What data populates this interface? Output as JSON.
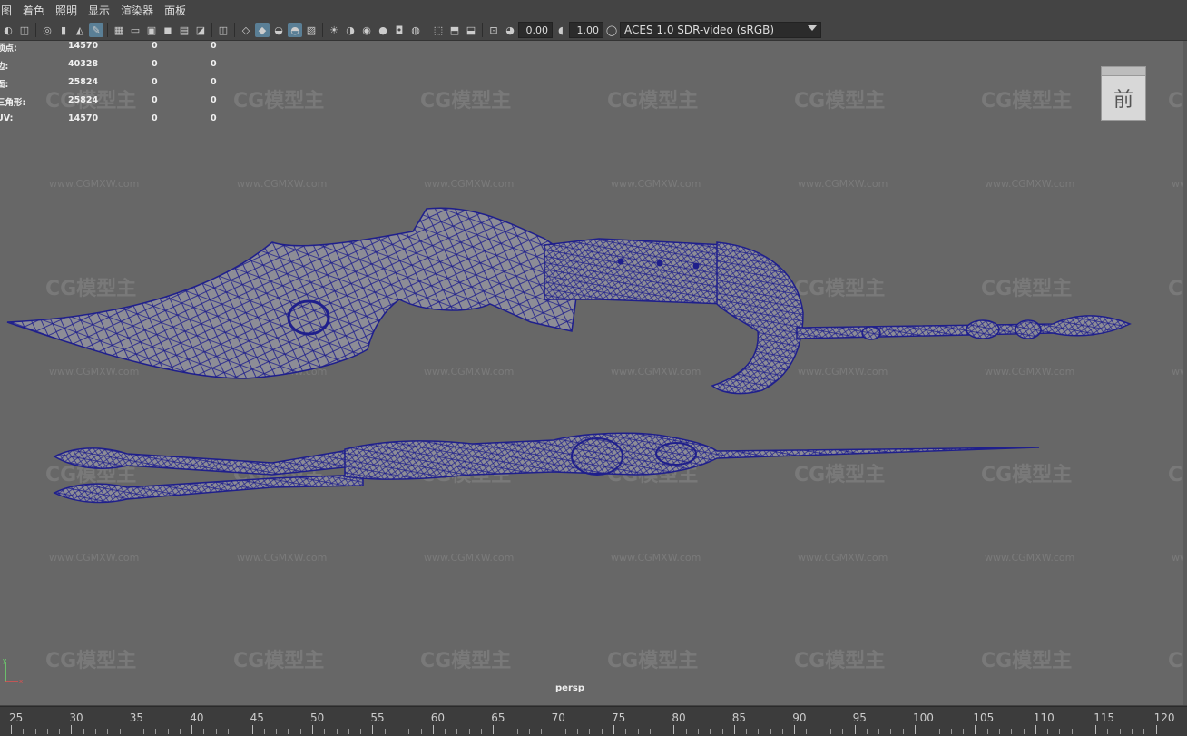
{
  "menu": {
    "items": [
      "图",
      "着色",
      "照明",
      "显示",
      "渲染器",
      "面板"
    ]
  },
  "toolbar": {
    "exposure_value": "0.00",
    "gamma_value": "1.00",
    "color_space": "ACES 1.0 SDR-video (sRGB)",
    "icons": [
      "camera-select-icon",
      "camera-attr-icon",
      "bookmark-icon",
      "image-plane-icon",
      "2d-pan-icon",
      "grease-pencil-icon",
      "grid-icon",
      "film-gate-icon",
      "resolution-gate-icon",
      "gate-mask-icon",
      "field-chart-icon",
      "safe-action-icon",
      "safe-title-icon",
      "wireframe-icon",
      "smooth-shade-icon",
      "default-material-icon",
      "wireframe-on-shaded-icon",
      "xray-icon",
      "use-all-lights-icon",
      "shadows-icon",
      "screen-space-ao-icon",
      "motion-blur-icon",
      "anti-alias-icon",
      "depth-of-field-icon",
      "isolate-select-icon",
      "xray-joints-icon",
      "xray-active-icon",
      "frame-all-icon",
      "exposure-icon",
      "gamma-icon",
      "color-mgmt-icon"
    ]
  },
  "hud": {
    "rows": [
      {
        "label": "顶点:",
        "v1": "14570",
        "v2": "0",
        "v3": "0"
      },
      {
        "label": "边:",
        "v1": "40328",
        "v2": "0",
        "v3": "0"
      },
      {
        "label": "面:",
        "v1": "25824",
        "v2": "0",
        "v3": "0"
      },
      {
        "label": "三角形:",
        "v1": "25824",
        "v2": "0",
        "v3": "0"
      },
      {
        "label": "UV:",
        "v1": "14570",
        "v2": "0",
        "v3": "0"
      }
    ]
  },
  "viewcube": {
    "face_label": "前"
  },
  "camera": {
    "name": "persp"
  },
  "watermark": {
    "logo": "CG模型主",
    "url": "www.CGMXW.com"
  },
  "ruler": {
    "labels": [
      "25",
      "30",
      "35",
      "40",
      "45",
      "50",
      "55",
      "60",
      "65",
      "70",
      "75",
      "80",
      "85",
      "90",
      "95",
      "100",
      "105",
      "110",
      "115",
      "120"
    ]
  },
  "colors": {
    "viewport_bg": "#676767",
    "wire": "#1f1f8c",
    "mesh_fill": "#8d8d96",
    "ui_bg": "#444444"
  }
}
